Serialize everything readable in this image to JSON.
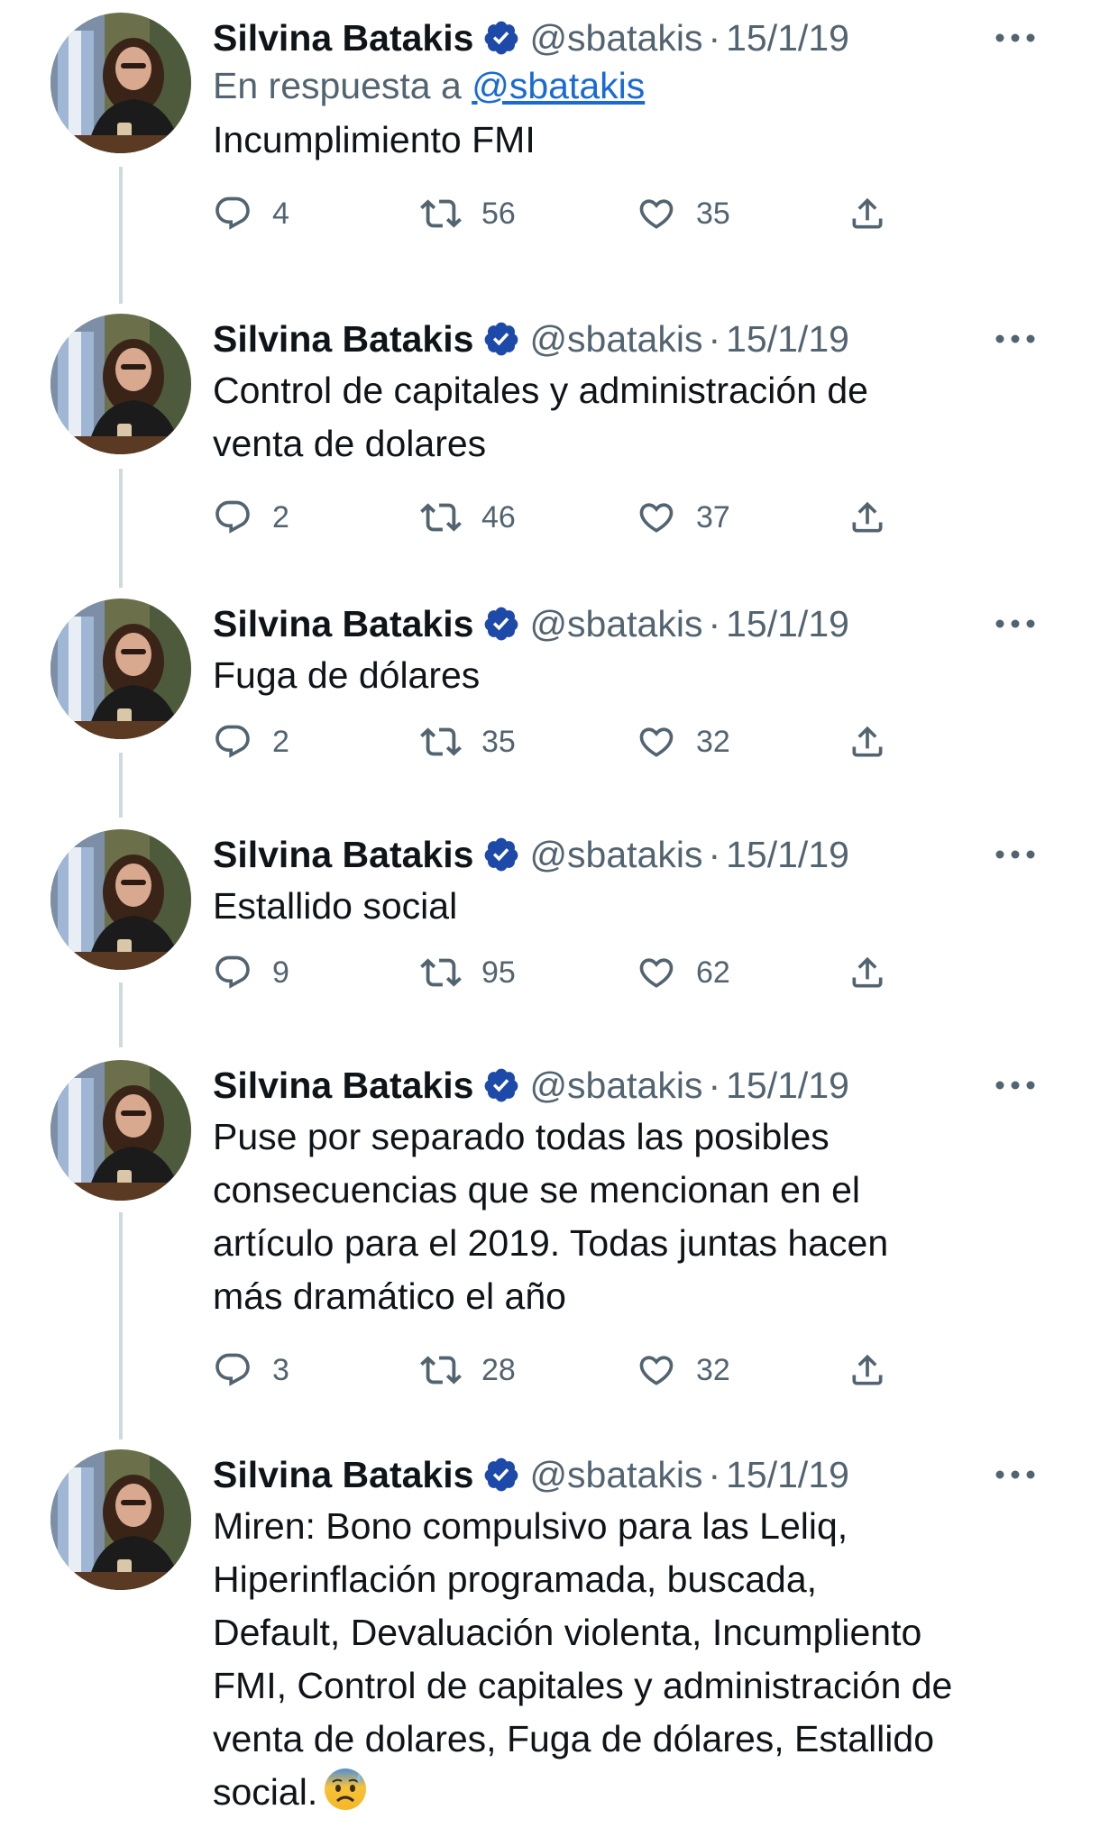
{
  "author": {
    "name": "Silvina Batakis",
    "handle": "@sbatakis",
    "separator": "·"
  },
  "colors": {
    "text": "#0f1419",
    "secondary": "#536471",
    "verified": "#1d4aa8",
    "link": "#1a6ad3",
    "thread_line": "#cfd9de"
  },
  "tweets": [
    {
      "date": "15/1/19",
      "reply_prefix": "En respuesta a",
      "reply_handle": "@sbatakis",
      "text": "Incumplimiento FMI",
      "replies": "4",
      "retweets": "56",
      "likes": "35"
    },
    {
      "date": "15/1/19",
      "text": "Control de capitales y administración de\nventa de dolares",
      "replies": "2",
      "retweets": "46",
      "likes": "37"
    },
    {
      "date": "15/1/19",
      "text": "Fuga de dólares",
      "replies": "2",
      "retweets": "35",
      "likes": "32"
    },
    {
      "date": "15/1/19",
      "text": "Estallido social",
      "replies": "9",
      "retweets": "95",
      "likes": "62"
    },
    {
      "date": "15/1/19",
      "text": "Puse por separado todas las posibles\nconsecuencias que se mencionan en el\nartículo para el 2019. Todas juntas hacen\nmás dramático el año",
      "replies": "3",
      "retweets": "28",
      "likes": "32"
    },
    {
      "date": "15/1/19",
      "text": "Miren: Bono compulsivo para las Leliq,\nHiperinflación programada, buscada,\nDefault, Devaluación violenta, Incumpliento\nFMI, Control de capitales y administración de\nventa de dolares, Fuga de dólares, Estallido\nsocial.",
      "emoji": "anxious-face-with-sweat-icon"
    }
  ]
}
